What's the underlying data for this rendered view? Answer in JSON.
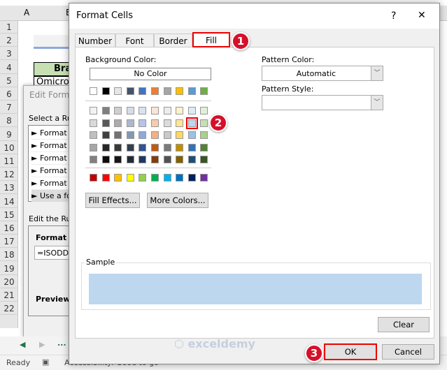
{
  "sheet": {
    "col_a": "A",
    "col_b": "B",
    "rows": [
      "1",
      "2",
      "3",
      "4",
      "5",
      "6",
      "7",
      "8",
      "9",
      "10",
      "11",
      "12",
      "13",
      "14",
      "15",
      "16",
      "17",
      "18",
      "19",
      "20",
      "21",
      "22"
    ],
    "header_cell": "Bra",
    "cell_b5": "Omicron",
    "status": "Ready",
    "accessibility": "Accessibility: Good to go",
    "sheet_nav_more": "..."
  },
  "edit_dialog": {
    "title": "Edit Formatting Rule",
    "select_rule": "Select a Rule Type:",
    "rules": [
      "► Format",
      "► Format",
      "► Format",
      "► Format",
      "► Format",
      "► Use a fo"
    ],
    "edit_rule": "Edit the Ru",
    "format_values": "Format va",
    "formula": "=ISODD(",
    "preview": "Preview:"
  },
  "dialog": {
    "title": "Format Cells",
    "help": "?",
    "close": "✕",
    "tabs": [
      "Number",
      "Font",
      "Border",
      "Fill"
    ],
    "active_tab": "Fill",
    "background_color_label": "Background Color:",
    "no_color": "No Color",
    "pattern_color_label": "Pattern Color:",
    "pattern_color_value": "Automatic",
    "pattern_style_label": "Pattern Style:",
    "pattern_style_value": "",
    "fill_effects": "Fill Effects...",
    "more_colors": "More Colors...",
    "sample_label": "Sample",
    "sample_color": "#BDD7EE",
    "clear": "Clear",
    "ok": "OK",
    "cancel": "Cancel"
  },
  "palette": {
    "theme": [
      "#FFFFFF",
      "#000000",
      "#E7E6E6",
      "#44546A",
      "#4472C4",
      "#ED7D31",
      "#A5A5A5",
      "#FFC000",
      "#5B9BD5",
      "#70AD47"
    ],
    "tints": [
      [
        "#F2F2F2",
        "#7F7F7F",
        "#D0CECE",
        "#D6DCE4",
        "#D9E1F2",
        "#FCE4D6",
        "#EDEDED",
        "#FFF2CC",
        "#DDEBF7",
        "#E2EFDA"
      ],
      [
        "#D9D9D9",
        "#595959",
        "#AEAAAA",
        "#ACB9CA",
        "#B4C6E7",
        "#F8CBAD",
        "#DBDBDB",
        "#FFE699",
        "#BDD7EE",
        "#C6E0B4"
      ],
      [
        "#BFBFBF",
        "#404040",
        "#757171",
        "#8497B0",
        "#8EA9DB",
        "#F4B084",
        "#C9C9C9",
        "#FFD966",
        "#9BC2E6",
        "#A9D08E"
      ],
      [
        "#A6A6A6",
        "#262626",
        "#3A3838",
        "#333F4F",
        "#305496",
        "#C65911",
        "#7B7B7B",
        "#BF8F00",
        "#2F75B5",
        "#548235"
      ],
      [
        "#808080",
        "#0D0D0D",
        "#161616",
        "#222B35",
        "#203764",
        "#833C0C",
        "#525252",
        "#806000",
        "#1F4E78",
        "#375623"
      ]
    ],
    "standard": [
      "#C00000",
      "#FF0000",
      "#FFC000",
      "#FFFF00",
      "#92D050",
      "#00B050",
      "#00B0F0",
      "#0070C0",
      "#002060",
      "#7030A0"
    ],
    "selected": "#BDD7EE"
  },
  "annotations": [
    "1",
    "2",
    "3"
  ],
  "watermark": {
    "name": "exceldemy",
    "tagline": "EXCEL · DATA · BI"
  }
}
